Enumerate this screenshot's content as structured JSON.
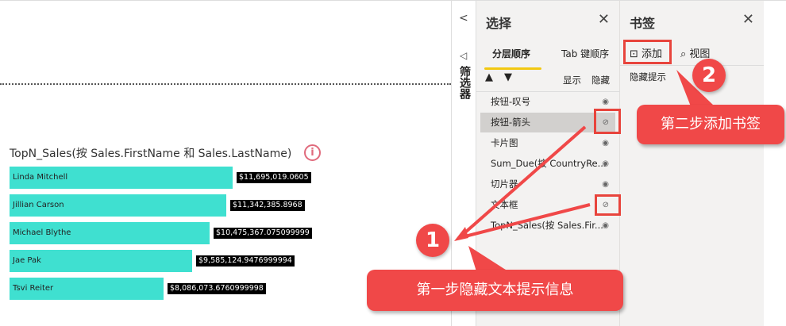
{
  "visual": {
    "title": "TopN_Sales(按 Sales.FirstName 和 Sales.LastName)",
    "info_icon": "i"
  },
  "chart_data": {
    "type": "bar",
    "title": "TopN_Sales(按 Sales.FirstName 和 Sales.LastName)",
    "categories": [
      "Linda Mitchell",
      "Jillian Carson",
      "Michael Blythe",
      "Jae Pak",
      "Tsvi Reiter"
    ],
    "values": [
      11695019.0605,
      11342385.8968,
      10475367.0751,
      9585124.9477,
      8086073.6761
    ],
    "labels": [
      "$11,695,019.0605",
      "$11,342,385.8968",
      "$10,475,367.075099999",
      "$9,585,124.9476999994",
      "$8,086,073.6760999998"
    ]
  },
  "filter_pane": {
    "label": "筛选器",
    "collapse": "<"
  },
  "selection": {
    "title": "选择",
    "close": "✕",
    "tabs": [
      "分层顺序",
      "Tab 键顺序"
    ],
    "show": "显示",
    "hide": "隐藏",
    "items": [
      {
        "label": "按钮-叹号",
        "hidden": false
      },
      {
        "label": "按钮-箭头",
        "hidden": true
      },
      {
        "label": "卡片图",
        "hidden": false
      },
      {
        "label": "Sum_Due(按 CountryRe...",
        "hidden": false
      },
      {
        "label": "切片器",
        "hidden": false
      },
      {
        "label": "文本框",
        "hidden": true
      },
      {
        "label": "TopN_Sales(按 Sales.Fir...",
        "hidden": false
      }
    ]
  },
  "bookmarks": {
    "title": "书签",
    "close": "✕",
    "add": "添加",
    "view": "视图",
    "items": [
      "隐藏提示"
    ]
  },
  "annotations": {
    "step1_num": "1",
    "step1": "第一步隐藏文本提示信息",
    "step2_num": "2",
    "step2": "第二步添加书签"
  },
  "colors": {
    "bar": "#3fe0d0",
    "annotation": "#f04848",
    "tab_underline": "#f2c811"
  }
}
